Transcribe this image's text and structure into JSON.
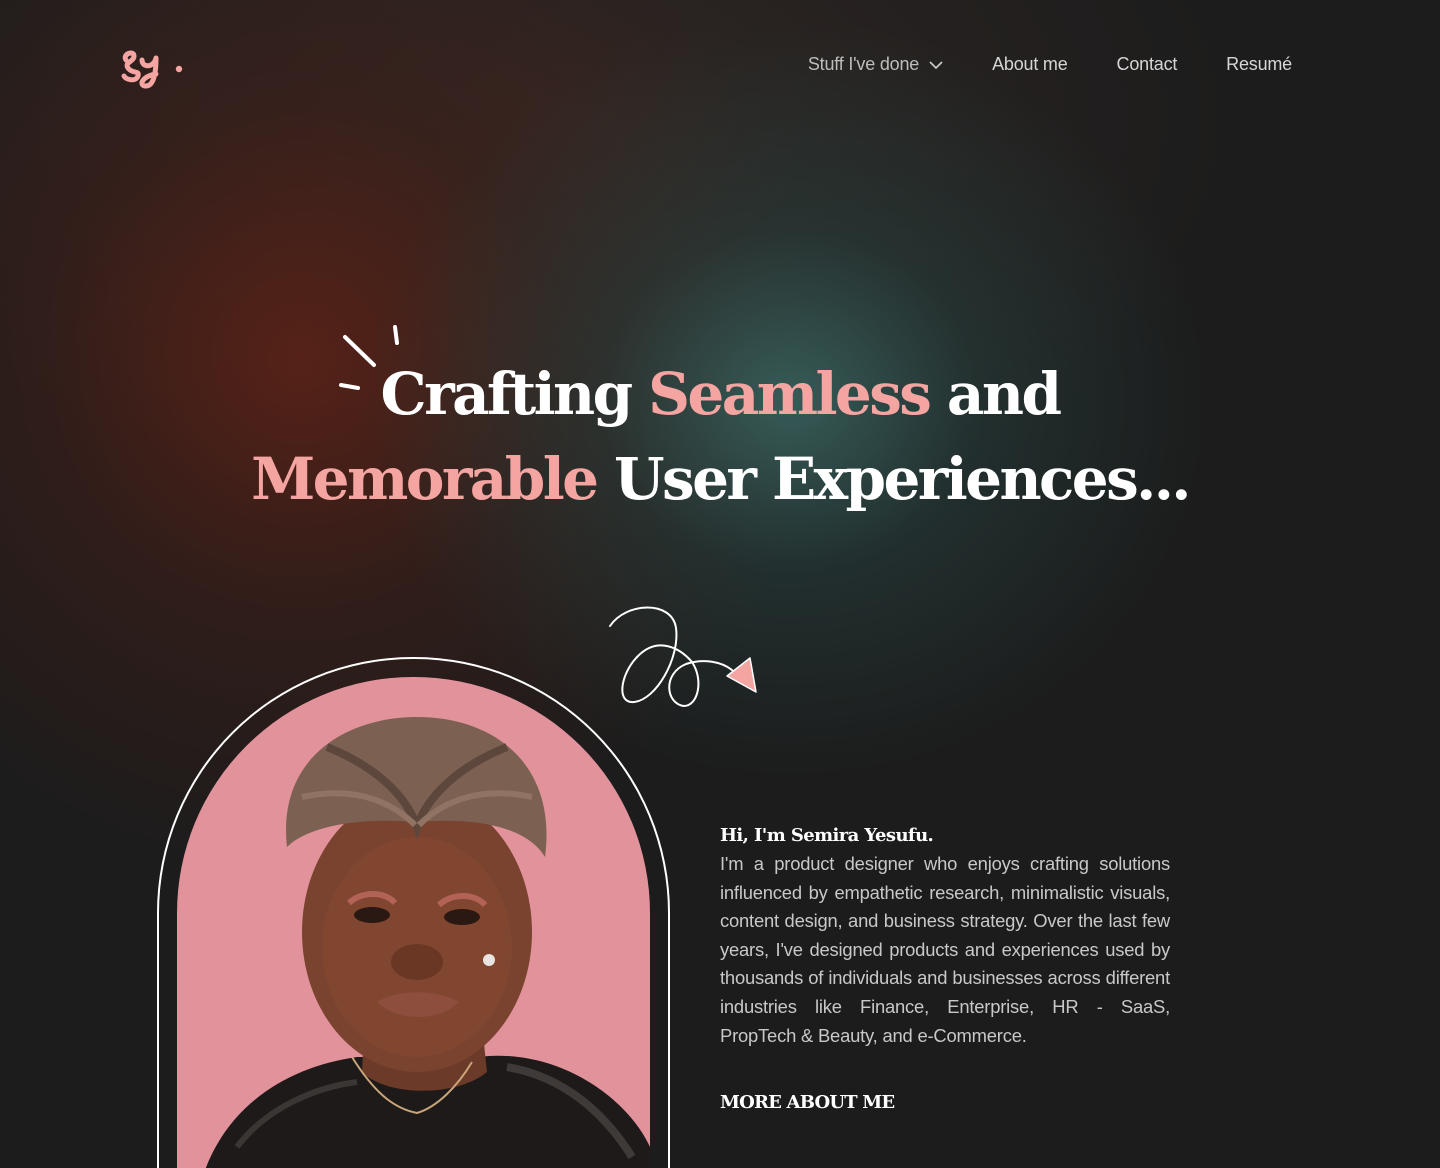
{
  "header": {
    "logo_text": "sy.",
    "nav": [
      {
        "label": "Stuff I've done",
        "icon": "chevron-down-icon"
      },
      {
        "label": "About me"
      },
      {
        "label": "Contact"
      },
      {
        "label": "Resumé"
      }
    ]
  },
  "hero": {
    "line1_part1": "Crafting ",
    "line1_accent": "Seamless",
    "line1_part2": " and",
    "line2_accent": "Memorable",
    "line2_part2": " User Experiences..."
  },
  "about": {
    "greeting": "Hi, I'm Semira Yesufu.",
    "bio": "I'm a product designer who enjoys crafting solutions influenced by empathetic research, minimalistic visuals, content design, and business strategy. Over the last few years, I've designed products and experiences used by thousands of individuals and businesses across different industries like Finance, Enterprise, HR - SaaS, PropTech & Beauty, and e-Commerce.",
    "cta": "MORE ABOUT ME"
  },
  "colors": {
    "accent": "#f4a4a1",
    "background": "#1c1c1c",
    "portrait_bg": "#e1929a"
  }
}
